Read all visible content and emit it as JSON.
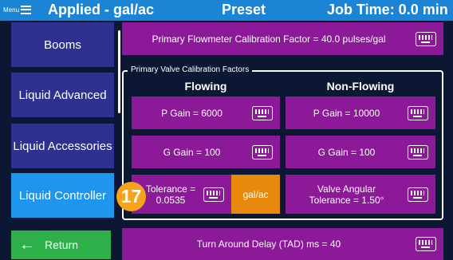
{
  "topbar": {
    "menu_label": "Menu",
    "title": "Applied - gal/ac",
    "mode": "Preset",
    "job_time": "Job Time: 0.0 min"
  },
  "sidebar": {
    "items": [
      {
        "label": "Booms"
      },
      {
        "label": "Liquid Advanced"
      },
      {
        "label": "Liquid Accessories"
      },
      {
        "label": "Liquid Controller"
      }
    ],
    "return_label": "Return"
  },
  "main": {
    "flowmeter_label": "Primary Flowmeter Calibration Factor = 40.0 pulses/gal",
    "group_title": "Primary Valve Calibration Factors",
    "flowing_header": "Flowing",
    "nonflowing_header": "Non-Flowing",
    "flowing_p_gain": "P Gain = 6000",
    "nonflowing_p_gain": "P Gain = 10000",
    "flowing_g_gain": "G Gain = 100",
    "nonflowing_g_gain": "G Gain = 100",
    "tolerance_line1": "Tolerance =",
    "tolerance_line2": "0.0535",
    "tolerance_unit": "gal/ac",
    "valve_angular_line1": "Valve Angular",
    "valve_angular_line2": "Tolerance = 1.50°",
    "tad_label": "Turn Around Delay (TAD) ms = 40"
  },
  "callout": {
    "number": "17"
  },
  "colors": {
    "topbar": "#1b84d4",
    "tile": "#8c1a98",
    "side": "#2e3190",
    "side_active": "#1e96f0",
    "unit": "#e8890c",
    "return": "#2eb04a",
    "badge": "#f6a21c"
  }
}
